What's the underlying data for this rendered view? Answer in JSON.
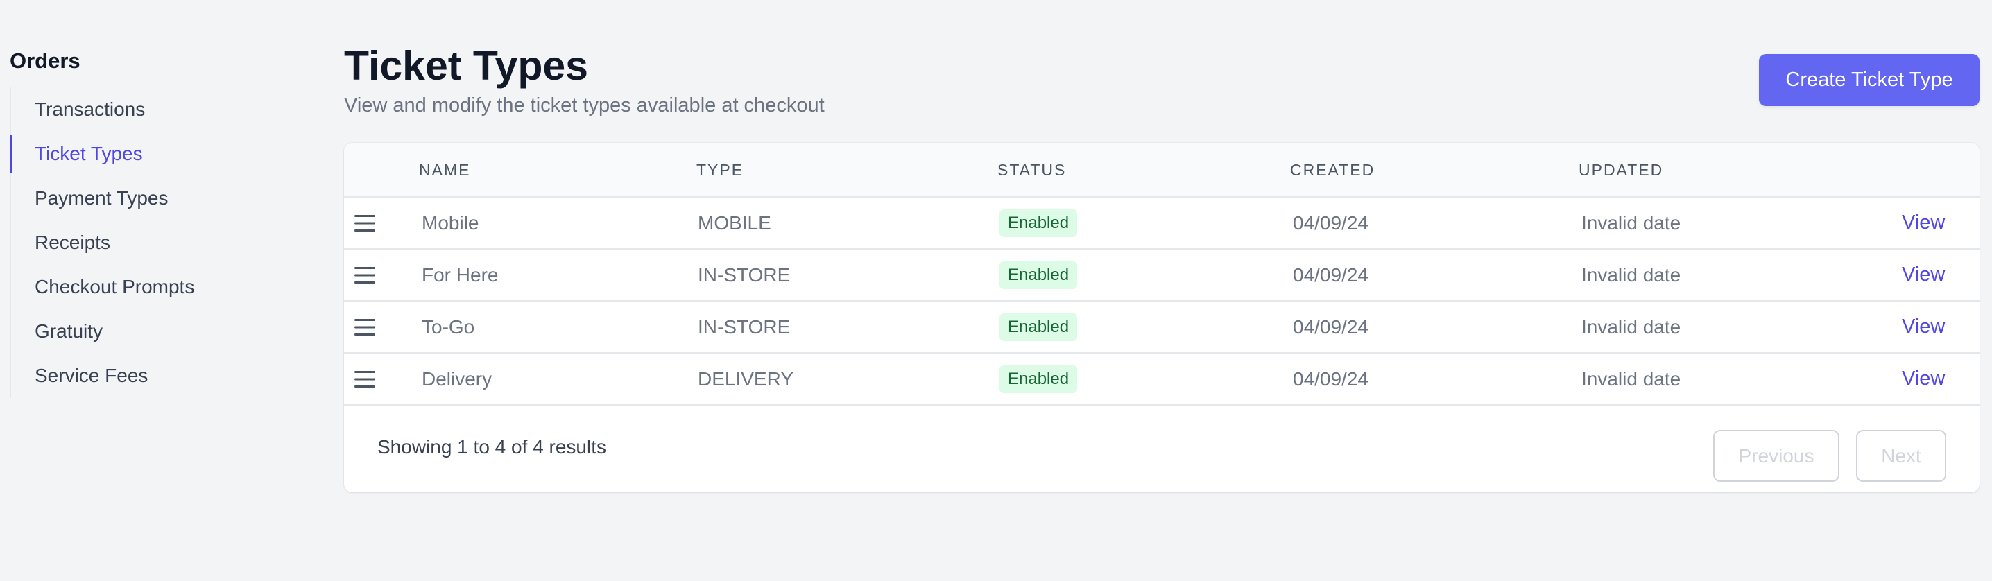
{
  "sidebar": {
    "title": "Orders",
    "items": [
      {
        "label": "Transactions",
        "active": false
      },
      {
        "label": "Ticket Types",
        "active": true
      },
      {
        "label": "Payment Types",
        "active": false
      },
      {
        "label": "Receipts",
        "active": false
      },
      {
        "label": "Checkout Prompts",
        "active": false
      },
      {
        "label": "Gratuity",
        "active": false
      },
      {
        "label": "Service Fees",
        "active": false
      }
    ]
  },
  "header": {
    "title": "Ticket Types",
    "subtitle": "View and modify the ticket types available at checkout",
    "create_label": "Create Ticket Type"
  },
  "table": {
    "columns": {
      "name": "Name",
      "type": "Type",
      "status": "Status",
      "created": "Created",
      "updated": "Updated"
    },
    "rows": [
      {
        "name": "Mobile",
        "type": "MOBILE",
        "status": "Enabled",
        "created": "04/09/24",
        "updated": "Invalid date",
        "action": "View"
      },
      {
        "name": "For Here",
        "type": "IN-STORE",
        "status": "Enabled",
        "created": "04/09/24",
        "updated": "Invalid date",
        "action": "View"
      },
      {
        "name": "To-Go",
        "type": "IN-STORE",
        "status": "Enabled",
        "created": "04/09/24",
        "updated": "Invalid date",
        "action": "View"
      },
      {
        "name": "Delivery",
        "type": "DELIVERY",
        "status": "Enabled",
        "created": "04/09/24",
        "updated": "Invalid date",
        "action": "View"
      }
    ]
  },
  "pagination": {
    "results_text": "Showing 1 to 4 of 4 results",
    "previous_label": "Previous",
    "next_label": "Next"
  },
  "icons": {
    "drag": "drag-handle-icon"
  },
  "colors": {
    "accent": "#6366f1",
    "active_link": "#4f46e5",
    "badge_bg": "#dcfce7",
    "badge_text": "#166534"
  }
}
